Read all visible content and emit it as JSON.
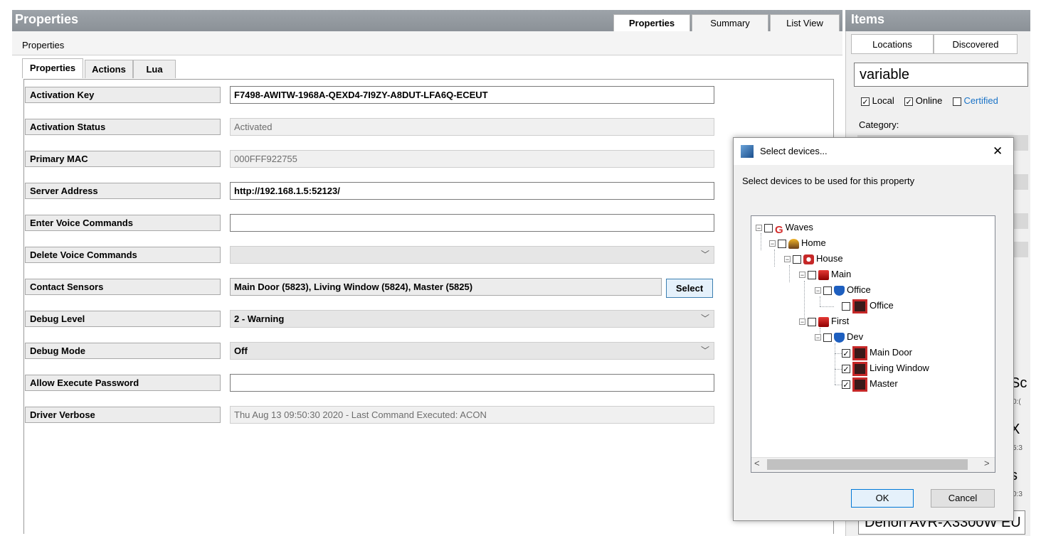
{
  "left_panel": {
    "title": "Properties",
    "tabs": [
      "Properties",
      "Summary",
      "List View"
    ],
    "subtitle": "Properties",
    "inner_tabs": [
      "Properties",
      "Actions",
      "Lua"
    ],
    "properties": [
      {
        "label": "Activation Key",
        "value": "F7498-AWITW-1968A-QEXD4-7I9ZY-A8DUT-LFA6Q-ECEUT"
      },
      {
        "label": "Activation Status",
        "value": "Activated"
      },
      {
        "label": "Primary MAC",
        "value": "000FFF922755"
      },
      {
        "label": "Server Address",
        "value": "http://192.168.1.5:52123/"
      },
      {
        "label": "Enter Voice Commands",
        "value": ""
      },
      {
        "label": "Delete Voice Commands",
        "value": ""
      },
      {
        "label": "Contact Sensors",
        "value": "Main Door (5823), Living Window (5824), Master (5825)"
      },
      {
        "label": "Debug Level",
        "value": "2 - Warning"
      },
      {
        "label": "Debug Mode",
        "value": "Off"
      },
      {
        "label": "Allow Execute Password",
        "value": ""
      },
      {
        "label": "Driver Verbose",
        "value": "Thu Aug 13 09:50:30 2020 - Last Command Executed: ACON"
      }
    ],
    "select_button": "Select"
  },
  "right_panel": {
    "title": "Items",
    "tabs": [
      "Locations",
      "Discovered"
    ],
    "search_value": "variable",
    "filters": {
      "local": "Local",
      "online": "Online",
      "certified": "Certified"
    },
    "category_label": "Category:",
    "peek_texts": [
      "Sc",
      "X",
      "s"
    ],
    "peek_subs": [
      "0:(",
      "5:3",
      "0:3"
    ],
    "bottom_item": "Denon AVR-X3300W EU"
  },
  "dialog": {
    "title": "Select devices...",
    "close": "✕",
    "instruction": "Select devices to be used for this property",
    "tree": [
      {
        "label": "Waves",
        "checked": false
      },
      {
        "label": "Home",
        "checked": false
      },
      {
        "label": "House",
        "checked": false
      },
      {
        "label": "Main",
        "checked": false
      },
      {
        "label": "Office",
        "checked": false
      },
      {
        "label": "Office",
        "checked": false
      },
      {
        "label": "First",
        "checked": false
      },
      {
        "label": "Dev",
        "checked": false
      },
      {
        "label": "Main Door",
        "checked": true
      },
      {
        "label": "Living Window",
        "checked": true
      },
      {
        "label": "Master",
        "checked": true
      }
    ],
    "scroll_left": "<",
    "scroll_right": ">",
    "ok": "OK",
    "cancel": "Cancel"
  },
  "colors": {
    "header_bg": "#959ba1",
    "select_border": "#3c7fb1",
    "ok_border": "#0078d7",
    "certified_link": "#1a73c7"
  }
}
